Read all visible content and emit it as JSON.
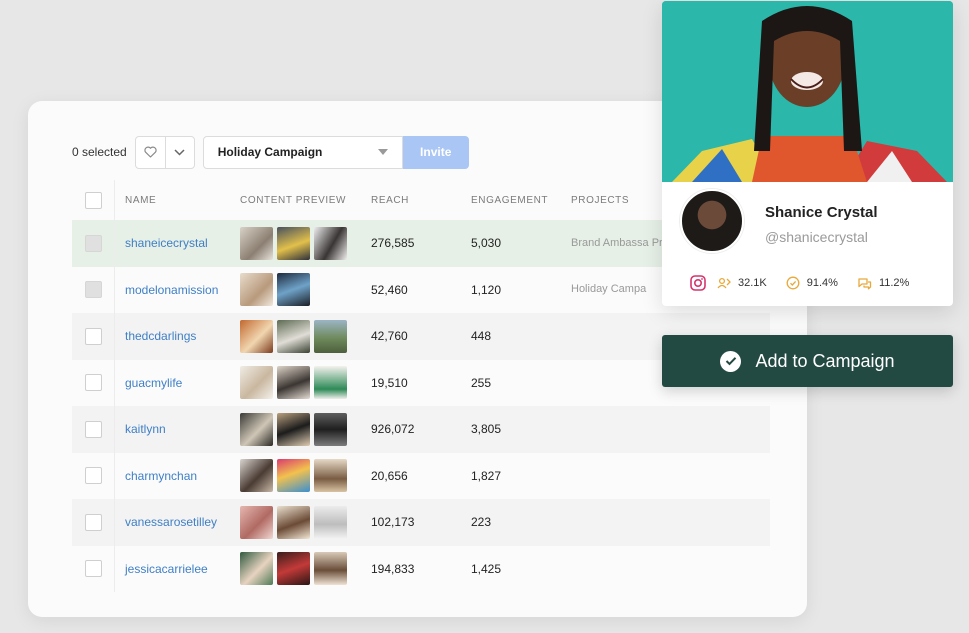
{
  "toolbar": {
    "selected_count": "0 selected",
    "campaign_value": "Holiday Campaign",
    "invite_label": "Invite"
  },
  "table": {
    "headers": {
      "name": "NAME",
      "preview": "CONTENT PREVIEW",
      "reach": "REACH",
      "engagement": "ENGAGEMENT",
      "projects": "PROJECTS"
    },
    "rows": [
      {
        "name": "shaneicecrystal",
        "reach": "276,585",
        "engagement": "5,030",
        "projects": "Brand Ambassa Program,  Holid"
      },
      {
        "name": "modelonamission",
        "reach": "52,460",
        "engagement": "1,120",
        "projects": "Holiday Campa"
      },
      {
        "name": "thedcdarlings",
        "reach": "42,760",
        "engagement": "448",
        "projects": ""
      },
      {
        "name": "guacmylife",
        "reach": "19,510",
        "engagement": "255",
        "projects": ""
      },
      {
        "name": "kaitlynn",
        "reach": "926,072",
        "engagement": "3,805",
        "projects": ""
      },
      {
        "name": "charmynchan",
        "reach": "20,656",
        "engagement": "1,827",
        "projects": ""
      },
      {
        "name": "vanessarosetilley",
        "reach": "102,173",
        "engagement": "223",
        "projects": ""
      },
      {
        "name": "jessicacarrielee",
        "reach": "194,833",
        "engagement": "1,425",
        "projects": ""
      }
    ]
  },
  "profile": {
    "name": "Shanice Crystal",
    "handle": "@shanicecrystal",
    "followers": "32.1K",
    "authenticity": "91.4%",
    "engagement_rate": "11.2%"
  },
  "cta": {
    "add_label": "Add to Campaign"
  },
  "colors": {
    "accent": "#234a42",
    "link": "#3f7fc6",
    "invite": "#a9c6f4",
    "hero_bg": "#2bb7aa",
    "highlight_row": "#e6f0e7"
  },
  "icons": {
    "favorite": "heart-icon",
    "dropdown": "chevron-down-icon",
    "platform": "instagram-icon",
    "followers": "followers-icon",
    "authenticity": "verified-badge-icon",
    "engagement": "chat-bubble-icon",
    "confirm": "check-circle-icon"
  }
}
